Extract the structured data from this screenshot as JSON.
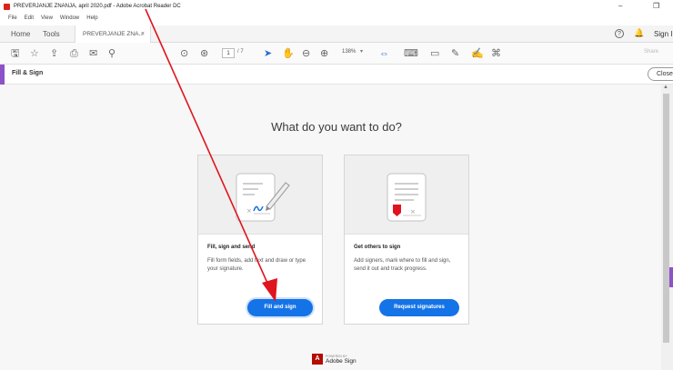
{
  "window": {
    "title": "PREVERJANJE ZNANJA, april 2020.pdf - Adobe Acrobat Reader DC",
    "minimize_glyph": "–",
    "restore_glyph": "❐"
  },
  "menu": [
    "File",
    "Edit",
    "View",
    "Window",
    "Help"
  ],
  "tabs": {
    "home": "Home",
    "tools": "Tools",
    "document": "PREVERJANJE ZNA...",
    "document_close": "×",
    "sign_in": "Sign In"
  },
  "toolbar": {
    "icons": [
      "save-icon",
      "bookmark-star-icon",
      "upload-icon",
      "print-icon",
      "email-icon",
      "search-icon",
      "page-up-icon",
      "page-down-icon",
      "select-cursor-icon",
      "hand-tool-icon",
      "zoom-out-icon",
      "zoom-in-icon",
      "fit-page-icon",
      "keyboard-tool-icon",
      "comment-icon",
      "pen-icon",
      "sign-icon",
      "stamp-icon"
    ],
    "page_current": "1",
    "page_total": "/ 7",
    "zoom": "138%",
    "share": "Share"
  },
  "fill_sign": {
    "title": "Fill & Sign",
    "close": "Close"
  },
  "main": {
    "heading": "What do you want to do?",
    "cards": [
      {
        "title": "Fill, sign and send",
        "description": "Fill form fields, add text and draw or type your signature.",
        "button": "Fill and sign"
      },
      {
        "title": "Get others to sign",
        "description": "Add signers, mark where to fill and sign, send it out and track progress.",
        "button": "Request signatures"
      }
    ],
    "powered_by": "POWERED BY",
    "adobe_sign": "Adobe Sign"
  },
  "colors": {
    "accent_purple": "#8c52c7",
    "button_blue": "#1473e6",
    "annotation_arrow": "#e0141e"
  }
}
